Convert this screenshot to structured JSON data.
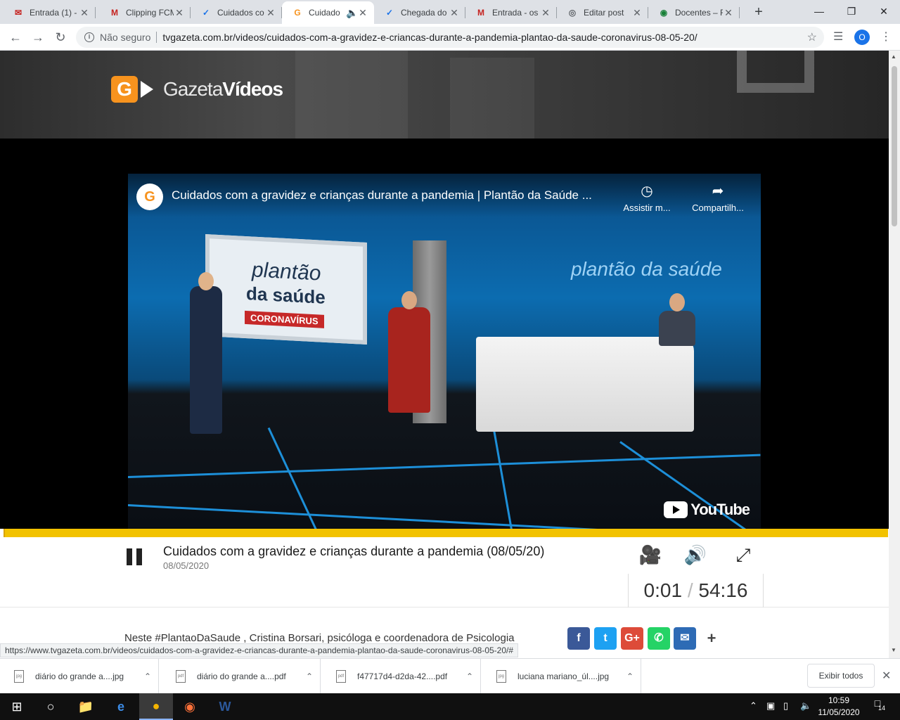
{
  "browser": {
    "tabs": [
      {
        "title": "Entrada (1) -",
        "favicon": "mail-icon",
        "fav_color": "#c5221f"
      },
      {
        "title": "Clipping FCM",
        "favicon": "gmail-icon",
        "fav_color": "#c5221f"
      },
      {
        "title": "Cuidados co",
        "favicon": "check-icon",
        "fav_color": "#1a73e8"
      },
      {
        "title": "Cuidado",
        "favicon": "gazeta-icon",
        "fav_color": "#f7931e",
        "active": true
      },
      {
        "title": "Chegada do",
        "favicon": "check-icon",
        "fav_color": "#1a73e8"
      },
      {
        "title": "Entrada - os",
        "favicon": "gmail-icon",
        "fav_color": "#c5221f"
      },
      {
        "title": "Editar post",
        "favicon": "wordpress-icon",
        "fav_color": "#5f6368"
      },
      {
        "title": "Docentes – F",
        "favicon": "globe-icon",
        "fav_color": "#188038"
      }
    ],
    "security_label": "Não seguro",
    "url": "tvgazeta.com.br/videos/cuidados-com-a-gravidez-e-criancas-durante-a-pandemia-plantao-da-saude-coronavirus-08-05-20/",
    "profile_initial": "O"
  },
  "site": {
    "logo_letter": "G",
    "logo_text_1": "Gazeta",
    "logo_text_2": "Vídeos"
  },
  "youtube": {
    "channel_letter": "G",
    "title": "Cuidados com a gravidez e crianças durante a pandemia | Plantão da Saúde ...",
    "watch_later": "Assistir m...",
    "share": "Compartilh...",
    "brand": "YouTube",
    "set": {
      "screen_line1": "plantão",
      "screen_line2": "da saúde",
      "screen_line3": "CORONAVÍRUS",
      "wall_title": "plantão da saúde"
    }
  },
  "player": {
    "progress_fraction": 0.0003,
    "title": "Cuidados com a gravidez e crianças durante a pandemia (08/05/20)",
    "date": "08/05/2020",
    "time_current": "0:01",
    "time_separator": "/",
    "time_total": "54:16"
  },
  "description": {
    "text": "Neste #PlantaoDaSaude , Cristina Borsari, psicóloga e coordenadora de Psicologia"
  },
  "share_buttons": [
    {
      "label": "f",
      "name": "facebook-share-button",
      "color": "#3b5998"
    },
    {
      "label": "t",
      "name": "twitter-share-button",
      "color": "#1da1f2"
    },
    {
      "label": "G+",
      "name": "google-plus-share-button",
      "color": "#dd4b39"
    },
    {
      "label": "✆",
      "name": "whatsapp-share-button",
      "color": "#25d366"
    },
    {
      "label": "✉",
      "name": "email-share-button",
      "color": "#2e6bb5"
    },
    {
      "label": "+",
      "name": "more-share-button",
      "color": "#ffffff"
    }
  ],
  "status_url": "https://www.tvgazeta.com.br/videos/cuidados-com-a-gravidez-e-criancas-durante-a-pandemia-plantao-da-saude-coronavirus-08-05-20/#",
  "downloads": {
    "items": [
      {
        "name": "diário do grande a....jpg",
        "type": "jpg"
      },
      {
        "name": "diário do grande a....pdf",
        "type": "pdf"
      },
      {
        "name": "f47717d4-d2da-42....pdf",
        "type": "pdf"
      },
      {
        "name": "luciana mariano_úl....jpg",
        "type": "jpg"
      }
    ],
    "show_all": "Exibir todos"
  },
  "taskbar": {
    "time": "10:59",
    "date": "11/05/2020",
    "notification_count": "14"
  }
}
